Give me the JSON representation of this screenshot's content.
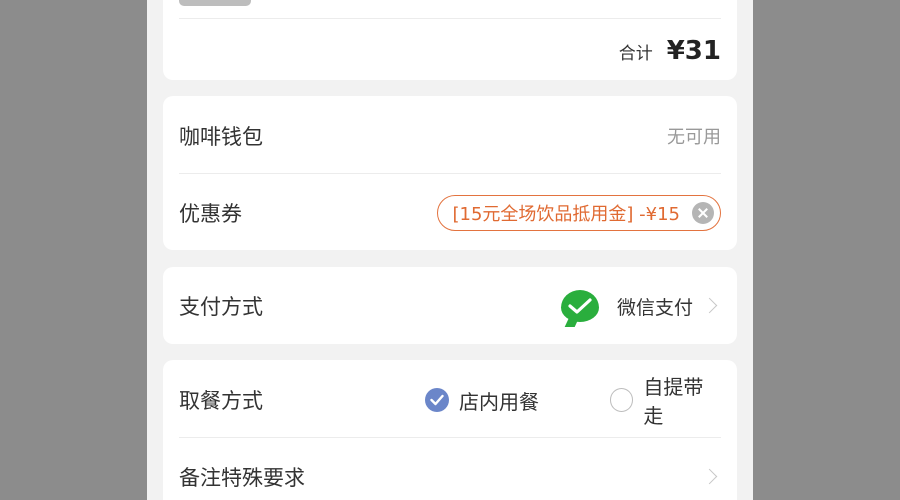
{
  "order_summary": {
    "total_label": "合计",
    "total_amount": "¥31"
  },
  "wallet": {
    "label": "咖啡钱包",
    "status": "无可用"
  },
  "coupon": {
    "label": "优惠券",
    "value": "[15元全场饮品抵用金] -¥15",
    "clear_icon": "close-circle-icon",
    "accent_color": "#e06a32"
  },
  "payment": {
    "label": "支付方式",
    "method": "微信支付",
    "method_icon": "wechat-pay-icon",
    "method_color": "#2aae3d"
  },
  "pickup": {
    "label": "取餐方式",
    "options": [
      {
        "label": "店内用餐",
        "selected": true
      },
      {
        "label": "自提带走",
        "selected": false
      }
    ],
    "selected_color": "#6b86c9"
  },
  "remarks": {
    "label": "备注特殊要求"
  }
}
